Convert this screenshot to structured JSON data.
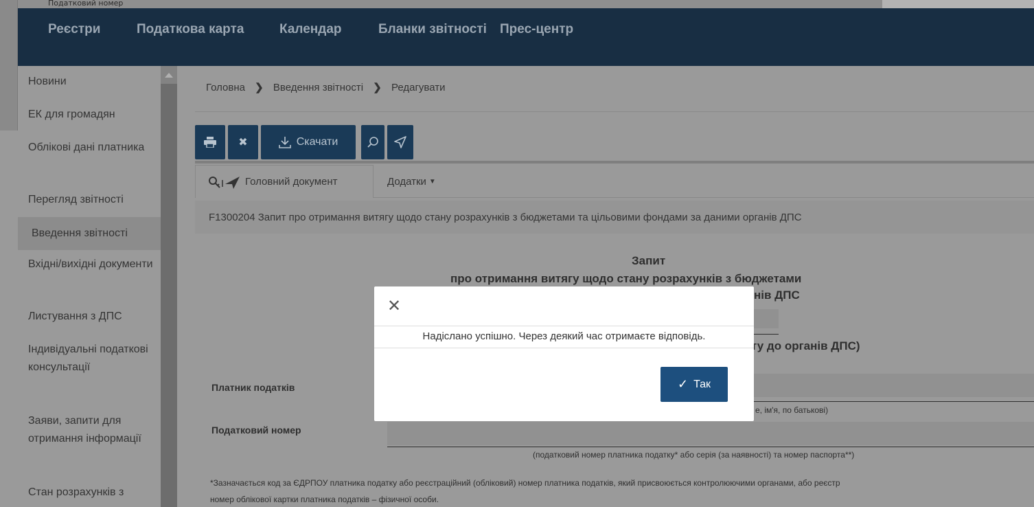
{
  "background": {
    "window_label": "Податковий номер"
  },
  "topnav": {
    "items": [
      {
        "label": "Реєстри"
      },
      {
        "label": "Податкова карта"
      },
      {
        "label": "Календар"
      },
      {
        "label": "Бланки звітності"
      },
      {
        "label": "Прес-центр"
      }
    ]
  },
  "sidebar": {
    "items": [
      {
        "label": "Новини"
      },
      {
        "label": "ЕК для громадян"
      },
      {
        "label": "Облікові дані платника"
      },
      {
        "label": "Перегляд звітності"
      },
      {
        "label": "Введення звітності",
        "active": true
      },
      {
        "label": "Вхідні/вихідні документи"
      },
      {
        "label": "Листування з ДПС"
      },
      {
        "label": "Індивідуальні податкові консультації"
      },
      {
        "label": "Заяви, запити для отримання інформації"
      },
      {
        "label": "Стан розрахунків з"
      }
    ]
  },
  "breadcrumb": {
    "home": "Головна",
    "section": "Введення звітності",
    "current": "Редагувати"
  },
  "toolbar": {
    "download_label": "Скачати",
    "icons": {
      "print": "print-icon",
      "close": "close-icon",
      "download": "download-icon",
      "search": "search-icon",
      "send": "send-icon"
    }
  },
  "tabs": {
    "main_document": "Головний документ",
    "attachments": "Додатки"
  },
  "document": {
    "title": "F1300204 Запит про отримання витягу щодо стану розрахунків з бюджетами та цільовими фондами за даними органів ДПС",
    "heading_line1": "Запит",
    "heading_line2": "про отримання витягу щодо стану розрахунків з бюджетами",
    "heading_line3_partial": "нів ДПС",
    "heading_line4_partial": "ту до органів ДПС)",
    "taxpayer_label": "Платник податків",
    "taxpayer_hint_partial": "е, ім'я, по батькові)",
    "tax_number_label": "Податковий номер",
    "tax_number_hint": "(податковий номер платника податку* або серія (за наявності) та номер паспорта**)",
    "footnote_line1": "*Зазначається код за ЄДРПОУ платника податку або реєстраційний (обліковий) номер платника податків, який присвоюється контролюючими органами, або реєстр",
    "footnote_line2": "номер облікової картки платника податків – фізичної особи."
  },
  "modal": {
    "message": "Надіслано успішно. Через деякий час отримаєте відповідь.",
    "ok_label": "Так"
  }
}
